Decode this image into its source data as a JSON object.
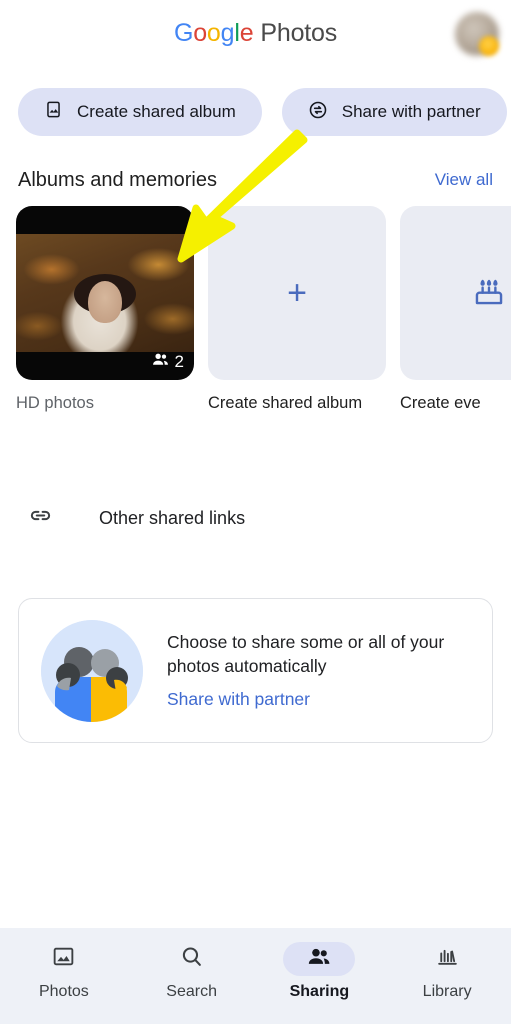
{
  "header": {
    "brand_google": "Google",
    "brand_letters": [
      "G",
      "o",
      "o",
      "g",
      "l",
      "e"
    ],
    "brand_colors": [
      "#4285F4",
      "#DB4437",
      "#F4B400",
      "#4285F4",
      "#0F9D58",
      "#DB4437"
    ],
    "product": "Photos",
    "avatar_label": "Account"
  },
  "chips": [
    {
      "label": "Create shared album",
      "icon": "album-icon"
    },
    {
      "label": "Share with partner",
      "icon": "partner-share-icon"
    }
  ],
  "section": {
    "title": "Albums and memories",
    "view_all": "View all"
  },
  "albums": [
    {
      "label": "HD photos",
      "type": "photo",
      "badge_count": "2",
      "badge_icon": "people-icon",
      "muted": true
    },
    {
      "label": "Create shared album",
      "type": "create",
      "icon": "plus-icon",
      "muted": false
    },
    {
      "label": "Create eve",
      "type": "create",
      "icon": "cake-icon",
      "muted": false
    }
  ],
  "other_links": {
    "label": "Other shared links",
    "icon": "link-icon"
  },
  "promo": {
    "title": "Choose to share some or all of your photos automatically",
    "link": "Share with partner",
    "illustration": "two-people-illustration"
  },
  "bottom_nav": {
    "items": [
      {
        "label": "Photos",
        "icon": "photo-icon",
        "active": false
      },
      {
        "label": "Search",
        "icon": "search-icon",
        "active": false
      },
      {
        "label": "Sharing",
        "icon": "people-icon",
        "active": true
      },
      {
        "label": "Library",
        "icon": "library-icon",
        "active": false
      }
    ]
  },
  "annotation": {
    "type": "arrow",
    "color": "#F5F000",
    "points_to": "HD photos album card"
  },
  "colors": {
    "chip_bg": "#dde1f5",
    "accent_link": "#3f6ad0",
    "nav_bg": "#eef1f7",
    "tile_blank_bg": "#eaecf3"
  }
}
